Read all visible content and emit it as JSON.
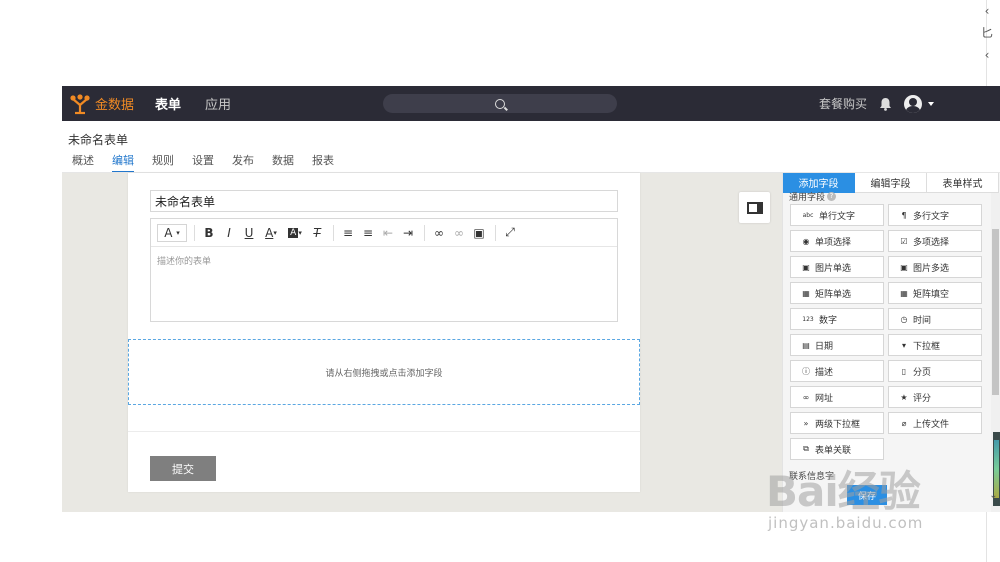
{
  "edge_glyphs": [
    "‹",
    "匕",
    "‹"
  ],
  "navbar": {
    "brand": "金数据",
    "nav_forms": "表单",
    "nav_apps": "应用",
    "plan_link": "套餐购买",
    "colors": {
      "bg": "#2b2b36",
      "brand": "#f08a24"
    }
  },
  "form": {
    "title": "未命名表单",
    "tabs": [
      "概述",
      "编辑",
      "规则",
      "设置",
      "发布",
      "数据",
      "报表"
    ],
    "active_tab": "编辑"
  },
  "editor": {
    "title_value": "未命名表单",
    "description_placeholder": "描述你的表单",
    "toolbar": [
      {
        "name": "font-size-icon",
        "glyph": "A"
      },
      {
        "name": "bold-icon",
        "glyph": "B"
      },
      {
        "name": "italic-icon",
        "glyph": "I"
      },
      {
        "name": "underline-icon",
        "glyph": "U"
      },
      {
        "name": "font-color-icon",
        "glyph": "A"
      },
      {
        "name": "bg-color-icon",
        "glyph": "A"
      },
      {
        "name": "clear-format-icon",
        "glyph": "T"
      },
      {
        "name": "ordered-list-icon",
        "glyph": "≡"
      },
      {
        "name": "unordered-list-icon",
        "glyph": "≡"
      },
      {
        "name": "outdent-icon",
        "glyph": "⇤"
      },
      {
        "name": "indent-icon",
        "glyph": "⇥"
      },
      {
        "name": "link-icon",
        "glyph": "∞"
      },
      {
        "name": "unlink-icon",
        "glyph": "∞"
      },
      {
        "name": "image-icon",
        "glyph": "▣"
      },
      {
        "name": "fullscreen-icon",
        "glyph": "⤢"
      }
    ],
    "dropzone_text": "请从右侧拖拽或点击添加字段",
    "submit_label": "提交"
  },
  "fields_panel": {
    "tabs": [
      "添加字段",
      "编辑字段",
      "表单样式"
    ],
    "active_tab": "添加字段",
    "section_common": "通用字段",
    "section_contact": "联系信息字",
    "partial_button": "保存",
    "fields": [
      {
        "label": "单行文字",
        "icon": "abc"
      },
      {
        "label": "多行文字",
        "icon": "¶"
      },
      {
        "label": "单项选择",
        "icon": "◉"
      },
      {
        "label": "多项选择",
        "icon": "☑"
      },
      {
        "label": "图片单选",
        "icon": "▣"
      },
      {
        "label": "图片多选",
        "icon": "▣"
      },
      {
        "label": "矩阵单选",
        "icon": "▦"
      },
      {
        "label": "矩阵填空",
        "icon": "▦"
      },
      {
        "label": "数字",
        "icon": "123"
      },
      {
        "label": "时间",
        "icon": "◷"
      },
      {
        "label": "日期",
        "icon": "▤"
      },
      {
        "label": "下拉框",
        "icon": "▾"
      },
      {
        "label": "描述",
        "icon": "ⓘ"
      },
      {
        "label": "分页",
        "icon": "▯"
      },
      {
        "label": "网址",
        "icon": "∞"
      },
      {
        "label": "评分",
        "icon": "★"
      },
      {
        "label": "两级下拉框",
        "icon": "»"
      },
      {
        "label": "上传文件",
        "icon": "⌀"
      },
      {
        "label": "表单关联",
        "icon": "⧉"
      }
    ],
    "colors": {
      "accent": "#2b8fe3"
    }
  },
  "watermark": {
    "brand": "Bai经验",
    "url": "jingyan.baidu.com"
  }
}
